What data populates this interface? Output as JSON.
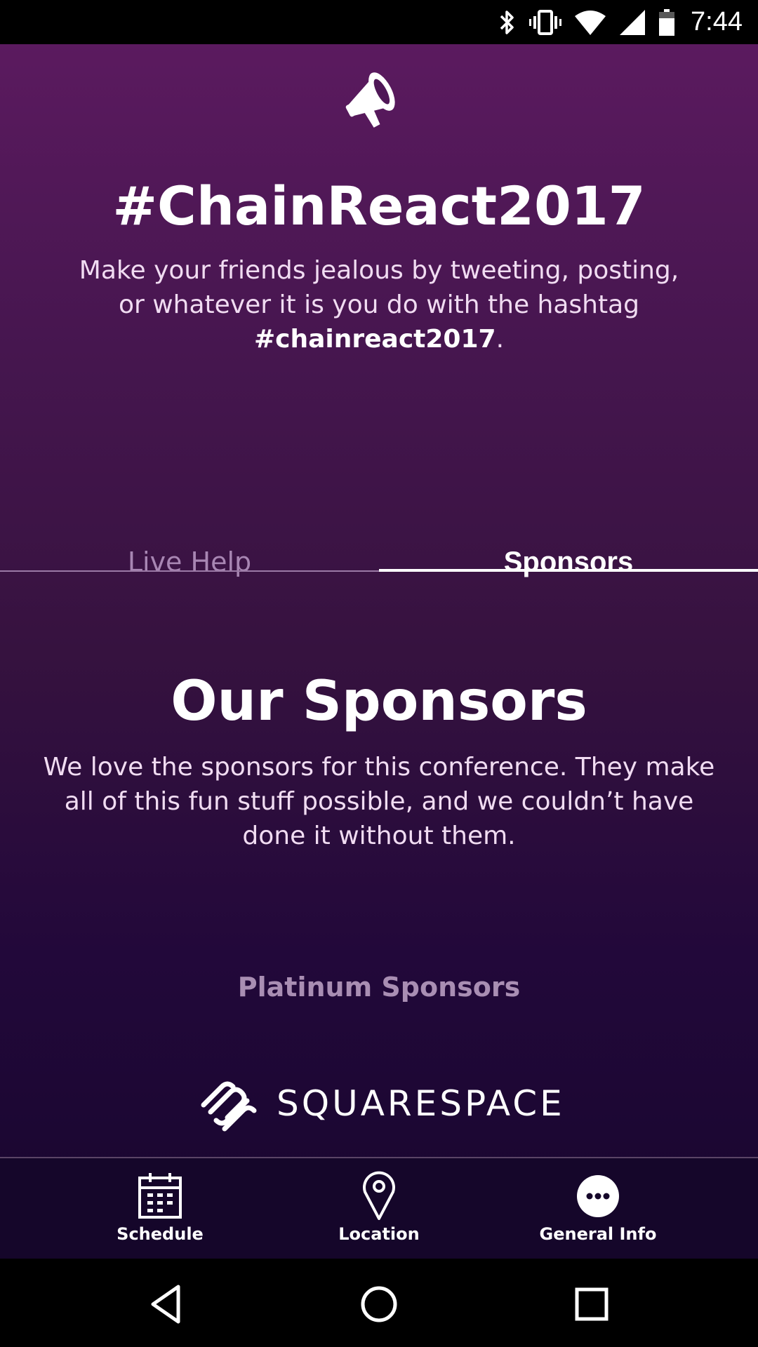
{
  "status_bar": {
    "time": "7:44",
    "icons": [
      "bluetooth-icon",
      "vibrate-icon",
      "wifi-icon",
      "signal-icon",
      "battery-icon"
    ]
  },
  "header": {
    "icon": "megaphone-icon",
    "title": "#ChainReact2017",
    "desc_prefix": "Make your friends jealous by tweeting, posting, or whatever it is you do with the hashtag ",
    "desc_hashtag": "#chainreact2017",
    "desc_suffix": "."
  },
  "tabs": [
    {
      "label": "Live Help",
      "selected": false
    },
    {
      "label": "Sponsors",
      "selected": true
    }
  ],
  "sponsors": {
    "title": "Our Sponsors",
    "description": "We love the sponsors for this conference. They make all of this fun stuff possible, and we couldn’t have done it without them.",
    "platinum_label": "Platinum Sponsors",
    "platinum": [
      {
        "name": "SQUARESPACE",
        "logo": "squarespace-logo"
      }
    ]
  },
  "bottom_nav": [
    {
      "label": "Schedule",
      "icon": "calendar-icon"
    },
    {
      "label": "Location",
      "icon": "location-pin-icon"
    },
    {
      "label": "General Info",
      "icon": "more-dots-icon"
    }
  ],
  "system_nav": [
    "back-icon",
    "home-icon",
    "recents-icon"
  ],
  "colors": {
    "gradient_top": "#5b1a5f",
    "gradient_bottom": "#18062e",
    "nav_background": "#15062a",
    "inactive_tab": "#a886b3",
    "muted_label": "#a98eb3"
  }
}
